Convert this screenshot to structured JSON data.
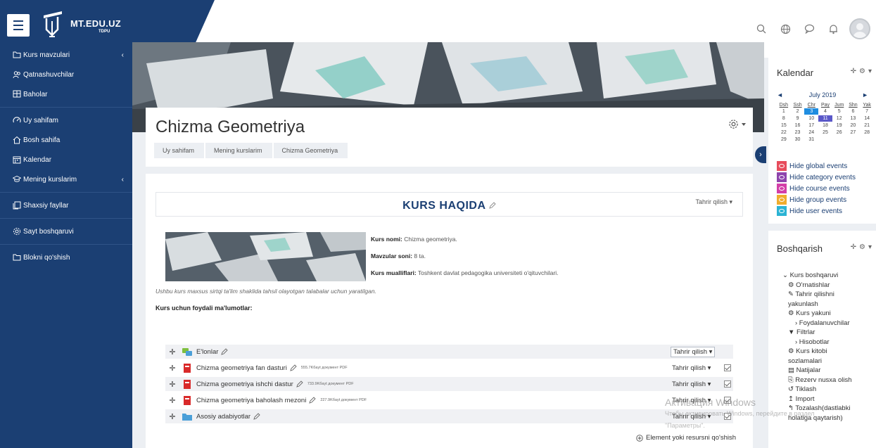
{
  "brand": {
    "name": "MT.EDU.UZ",
    "sub": "TDPU"
  },
  "drawer": {
    "group1": [
      {
        "label": "Kurs mavzulari",
        "icon": "folder-icon",
        "chevron": "‹"
      },
      {
        "label": "Qatnashuvchilar",
        "icon": "users-icon"
      },
      {
        "label": "Baholar",
        "icon": "grades-icon"
      }
    ],
    "group2": [
      {
        "label": "Uy sahifam",
        "icon": "dashboard-icon"
      },
      {
        "label": "Bosh sahifa",
        "icon": "home-icon"
      },
      {
        "label": "Kalendar",
        "icon": "calendar-icon"
      },
      {
        "label": "Mening kurslarim",
        "icon": "graduation-cap-icon",
        "chevron": "‹"
      }
    ],
    "group3": [
      {
        "label": "Shaxsiy fayllar",
        "icon": "files-icon"
      }
    ],
    "group4": [
      {
        "label": "Sayt boshqaruvi",
        "icon": "gear-icon"
      }
    ],
    "group5": [
      {
        "label": "Blokni qo'shish",
        "icon": "add-block-icon"
      }
    ]
  },
  "header": {
    "title": "Chizma Geometriya",
    "breadcrumb": [
      "Uy sahifam",
      "Mening kurslarim",
      "Chizma Geometriya"
    ]
  },
  "section": {
    "title": "KURS HAQIDA",
    "edit_label": "Tahrir qilish ▾"
  },
  "course_info": {
    "name_label": "Kurs nomi:",
    "name_value": " Chizma geometriya.",
    "topics_label": "Mavzular soni:",
    "topics_value": " 8 ta.",
    "authors_label": "Kurs mualliflari:",
    "authors_value": " Toshkent davlat pedagogika universiteti o'qituvchilari.",
    "description": "Ushbu kurs maxsus sirtqi ta'lim shaklida tahsil olayotgan talabalar uchun yaratilgan.",
    "useful": "Kurs uchun foydali ma'lumotlar:"
  },
  "activities": [
    {
      "name": "E'lonlar",
      "type": "forum",
      "meta": "",
      "edit": "Tahrir qilish ▾"
    },
    {
      "name": "Chizma geometriya fan dasturi",
      "type": "pdf",
      "meta": "555.7Kбayt документ PDF",
      "edit": "Tahrir qilish ▾"
    },
    {
      "name": "Chizma geometriya ishchi dastur",
      "type": "pdf",
      "meta": "733.9Kбayt документ PDF",
      "edit": "Tahrir qilish ▾"
    },
    {
      "name": "Chizma geometriya baholash mezoni",
      "type": "pdf",
      "meta": "227.9Kбayt документ PDF",
      "edit": "Tahrir qilish ▾"
    },
    {
      "name": "Asosiy adabiyotlar",
      "type": "folder",
      "meta": "",
      "edit": "Tahrir qilish ▾"
    }
  ],
  "add_activity": "Element yoki resursni qo'shish",
  "calendar": {
    "title": "Kalendar",
    "month": "July 2019",
    "prev": "◄",
    "next": "►",
    "day_headers": [
      "Dsh",
      "Ssh",
      "Chr",
      "Pay",
      "Jum",
      "Shn",
      "Yak"
    ],
    "days": [
      "1",
      "2",
      "3",
      "4",
      "5",
      "6",
      "7",
      "8",
      "9",
      "10",
      "11",
      "12",
      "13",
      "14",
      "15",
      "16",
      "17",
      "18",
      "19",
      "20",
      "21",
      "22",
      "23",
      "24",
      "25",
      "26",
      "27",
      "28",
      "29",
      "30",
      "31"
    ],
    "highlight_blue": "3",
    "highlight_today": "11",
    "events": [
      {
        "label": "Hide global events",
        "color": "#e74c5c"
      },
      {
        "label": "Hide category events",
        "color": "#8e44ad"
      },
      {
        "label": "Hide course events",
        "color": "#d33ea8"
      },
      {
        "label": "Hide group events",
        "color": "#f0ad2e"
      },
      {
        "label": "Hide user events",
        "color": "#2bb3d4"
      }
    ]
  },
  "admin": {
    "title": "Boshqarish",
    "items": [
      {
        "label": "⌄ Kurs boshqaruvi",
        "indent": 0
      },
      {
        "label": "⚙ O'rnatishlar",
        "indent": 1
      },
      {
        "label": "✎ Tahrir qilishni",
        "indent": 1
      },
      {
        "label": "yakunlash",
        "indent": 1
      },
      {
        "label": "⚙ Kurs yakuni",
        "indent": 1
      },
      {
        "label": "› Foydalanuvchilar",
        "indent": 2
      },
      {
        "label": "▼ Filtrlar",
        "indent": 1
      },
      {
        "label": "› Hisobotlar",
        "indent": 2
      },
      {
        "label": "⚙ Kurs kitobi",
        "indent": 1
      },
      {
        "label": "sozlamalari",
        "indent": 1
      },
      {
        "label": "▤ Natijalar",
        "indent": 1
      },
      {
        "label": "⎘ Rezerv nusxa olish",
        "indent": 1
      },
      {
        "label": "↺ Tiklash",
        "indent": 1
      },
      {
        "label": "↥ Import",
        "indent": 1
      },
      {
        "label": "↰ Tozalash(dastlabki",
        "indent": 1
      },
      {
        "label": "holatiga qaytarish)",
        "indent": 1
      }
    ]
  },
  "watermark": {
    "line1": "Активация Windows",
    "line2": "Чтобы активировать Windows, перейдите в раздел",
    "line3": "\"Параметры\"."
  },
  "colors": {
    "primary": "#1b3f73",
    "bg": "#eceff3"
  }
}
